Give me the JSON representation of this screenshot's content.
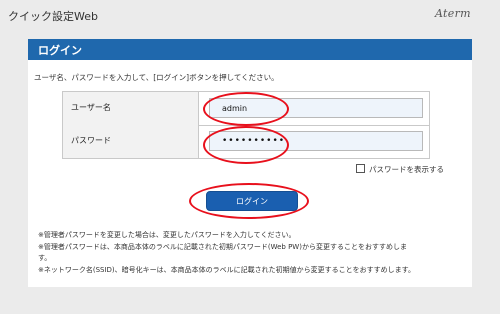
{
  "header": {
    "app_title": "クイック設定Web",
    "logo_text": "Aterm"
  },
  "panel": {
    "title": "ログイン",
    "instruction": "ユーザ名、パスワードを入力して、[ログイン]ボタンを押してください。"
  },
  "form": {
    "username_label": "ユーザー名",
    "username_value": "admin",
    "password_label": "パスワード",
    "password_value": "••••••••••",
    "show_password_label": "パスワードを表示する",
    "show_password_checked": false
  },
  "login_button_label": "ログイン",
  "notes": [
    "※管理者パスワードを変更した場合は、変更したパスワードを入力してください。",
    "※管理者パスワードは、本商品本体のラベルに記載された初期パスワード(Web PW)から変更することをおすすめしま",
    "す。",
    "※ネットワーク名(SSID)、暗号化キーは、本商品本体のラベルに記載された初期値から変更することをおすすめします。"
  ],
  "colors": {
    "header_blue": "#1f68ad",
    "button_blue": "#1a5fb0",
    "annotation_red": "#e8101c",
    "background": "#ebebeb"
  }
}
